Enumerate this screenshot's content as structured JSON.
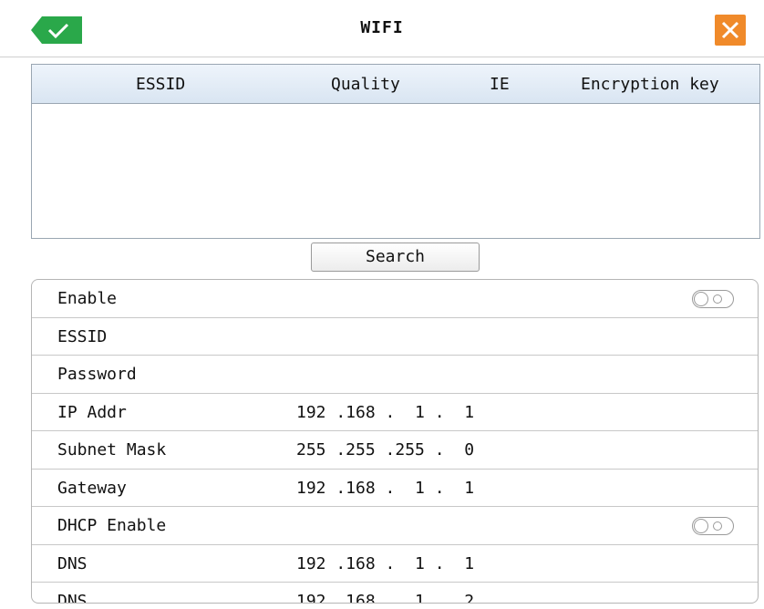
{
  "window": {
    "title": "WIFI",
    "accent_confirm": "#2aa84a",
    "accent_close": "#f08a2a"
  },
  "network_table": {
    "columns": [
      "ESSID",
      "Quality",
      "IE",
      "Encryption key"
    ],
    "rows": []
  },
  "search_label": "Search",
  "settings": {
    "enable": {
      "label": "Enable",
      "toggle": "off"
    },
    "essid": {
      "label": "ESSID",
      "value": ""
    },
    "password": {
      "label": "Password",
      "value": ""
    },
    "ip_addr": {
      "label": "IP Addr",
      "value": "192 .168 .  1 .  1"
    },
    "subnet_mask": {
      "label": "Subnet Mask",
      "value": "255 .255 .255 .  0"
    },
    "gateway": {
      "label": "Gateway",
      "value": "192 .168 .  1 .  1"
    },
    "dhcp_enable": {
      "label": "DHCP Enable",
      "toggle": "off"
    },
    "dns1": {
      "label": "DNS",
      "value": "192 .168 .  1 .  1"
    },
    "dns2": {
      "label": "DNS",
      "value": "192 .168 .  1 .  2"
    }
  }
}
